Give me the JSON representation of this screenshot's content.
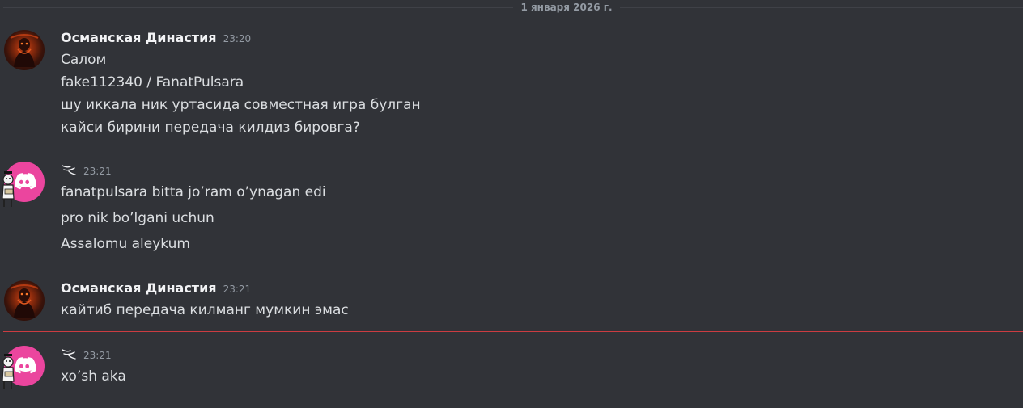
{
  "date_divider": "1 января 2026 г.",
  "messages": [
    {
      "author": "Османская Династия",
      "time": "23:20",
      "lines": [
        "Салом",
        "fake112340 / FanatPulsara",
        "шу иккала ник уртасида совместная игра булган",
        "кайси бирини передача килдиз бировга?"
      ]
    },
    {
      "author": "",
      "time": "23:21",
      "lines": [
        "fanatpulsara bitta jo’ram o’ynagan edi",
        "pro nik bo’lgani uchun",
        "Assalomu aleykum"
      ]
    },
    {
      "author": "Османская Династия",
      "time": "23:21",
      "lines": [
        "кайтиб передача килманг мумкин эмас"
      ]
    },
    {
      "author": "",
      "time": "23:21",
      "lines": [
        "xo’sh aka"
      ]
    }
  ],
  "colors": {
    "background": "#313338",
    "new_messages_divider": "#f23f43",
    "discord_avatar": "#eb459e"
  }
}
